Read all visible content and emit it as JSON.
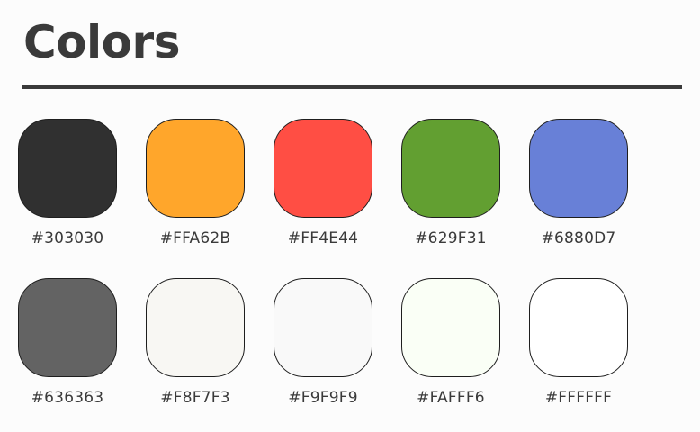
{
  "page": {
    "title": "Colors"
  },
  "swatches": [
    {
      "label": "#303030",
      "color": "#303030"
    },
    {
      "label": "#FFA62B",
      "color": "#FFA62B"
    },
    {
      "label": "#FF4E44",
      "color": "#FF4E44"
    },
    {
      "label": "#629F31",
      "color": "#629F31"
    },
    {
      "label": "#6880D7",
      "color": "#6880D7"
    },
    {
      "label": "#636363",
      "color": "#636363"
    },
    {
      "label": "#F8F7F3",
      "color": "#F8F7F3"
    },
    {
      "label": "#F9F9F9",
      "color": "#F9F9F9"
    },
    {
      "label": "#FAFFF6",
      "color": "#FAFFF6"
    },
    {
      "label": "#FFFFFF",
      "color": "#FFFFFF"
    }
  ]
}
